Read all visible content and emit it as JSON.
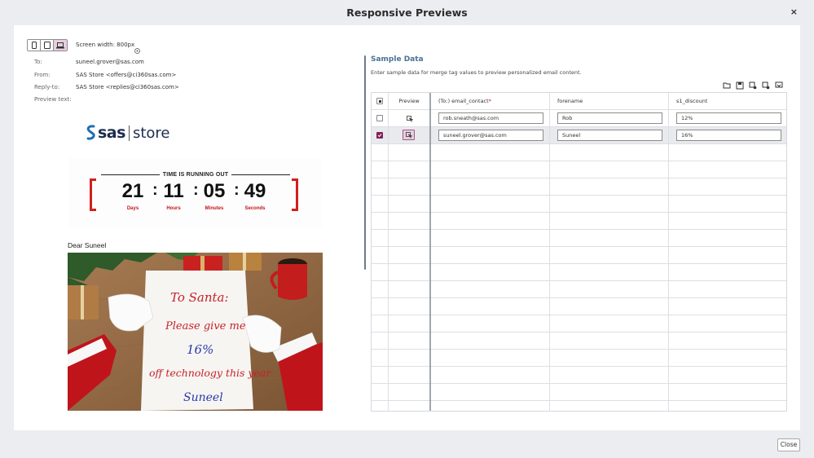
{
  "dialog": {
    "title": "Responsive Previews",
    "close_glyph": "×",
    "footer_close_label": "Close"
  },
  "preview": {
    "devices": [
      {
        "icon": "mobile-icon",
        "active": false
      },
      {
        "icon": "tablet-icon",
        "active": false
      },
      {
        "icon": "desktop-icon",
        "active": true
      }
    ],
    "screen_width_label": "Screen width: 800px",
    "meta": {
      "to_label": "To:",
      "to": "suneel.grover@sas.com",
      "from_label": "From:",
      "from": "SAS Store <offers@ci360sas.com>",
      "reply_label": "Reply-to:",
      "reply": "SAS Store <replies@ci360sas.com>",
      "preview_label": "Preview text:"
    },
    "logo": {
      "brand": "sas",
      "store": "store"
    },
    "countdown": {
      "title": "TIME IS RUNNING OUT",
      "days": "21",
      "hours": "11",
      "minutes": "05",
      "seconds": "49",
      "days_label": "Days",
      "hours_label": "Hours",
      "minutes_label": "Minutes",
      "seconds_label": "Seconds",
      "sep": ":"
    },
    "greeting": "Dear Suneel",
    "image_text": {
      "line1": "To Santa:",
      "line2": "Please give me",
      "line3": "16%",
      "line4": "off technology this year",
      "line5": "Suneel"
    }
  },
  "sample": {
    "title": "Sample Data",
    "description": "Enter sample data for merge tag values to preview personalized email content.",
    "toolbar_icons": [
      "open-folder-icon",
      "save-icon",
      "settings-icon",
      "delete-icon",
      "import-icon"
    ],
    "columns": {
      "preview": "Preview",
      "email": "(To:) email_contact",
      "required": "*",
      "forename": "forename",
      "discount": "s1_discount"
    },
    "rows": [
      {
        "checked": false,
        "email": "rob.sneath@sas.com",
        "forename": "Rob",
        "discount": "12%",
        "active": false
      },
      {
        "checked": true,
        "email": "suneel.grover@sas.com",
        "forename": "Suneel",
        "discount": "16%",
        "active": true
      }
    ]
  },
  "colors": {
    "accent": "#7f2457",
    "accent_light": "#e6cfe0",
    "countdown_red": "#d21f1f",
    "title_blue": "#4b7195"
  }
}
